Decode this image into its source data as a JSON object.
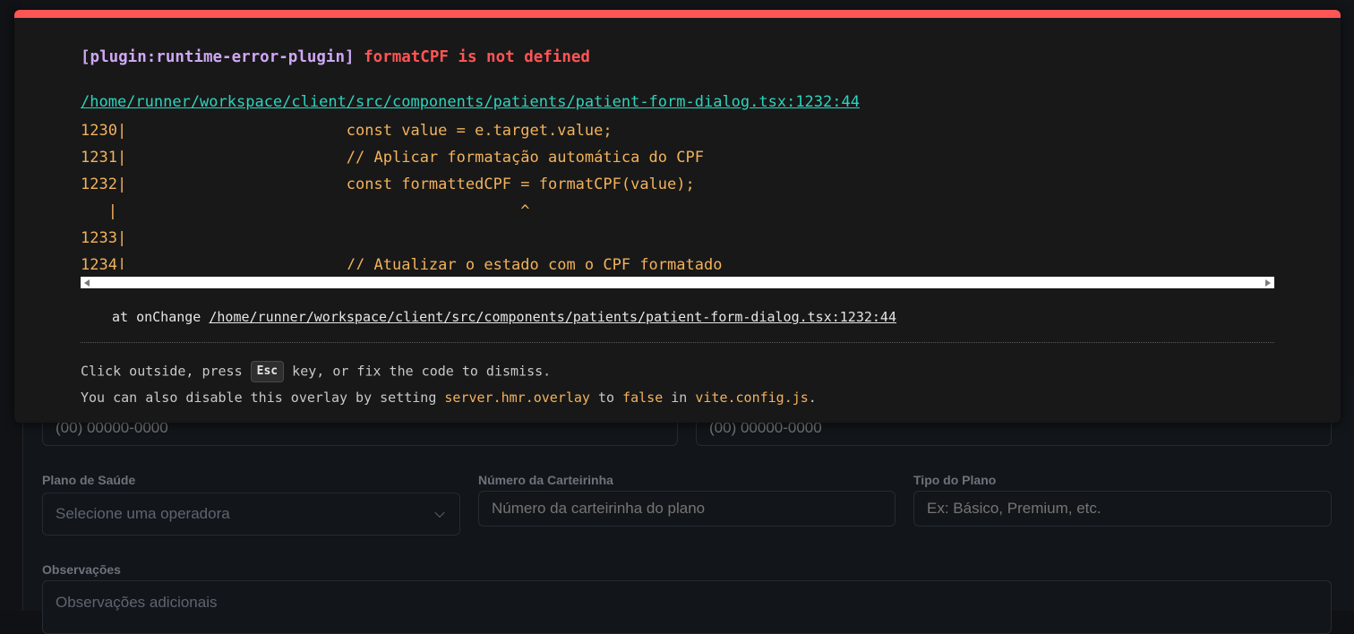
{
  "overlay": {
    "plugin": "[plugin:runtime-error-plugin]",
    "message": "formatCPF is not defined",
    "file": "/home/runner/workspace/client/src/components/patients/patient-form-dialog.tsx:1232:44",
    "frame_lines": [
      "1230|                        const value = e.target.value;",
      "1231|                        // Aplicar formatação automática do CPF",
      "1232|                        const formattedCPF = formatCPF(value);",
      "   |                                            ^",
      "1233|",
      "1234|                        // Atualizar o estado com o CPF formatado"
    ],
    "stack_prefix": "at onChange ",
    "stack_path": "/home/runner/workspace/client/src/components/patients/patient-form-dialog.tsx:1232:44",
    "tip1_before": "Click outside, press ",
    "tip1_key": "Esc",
    "tip1_after": " key, or fix the code to dismiss.",
    "tip2_a": "You can also disable this overlay by setting ",
    "tip2_code1": "server.hmr.overlay",
    "tip2_b": " to ",
    "tip2_code2": "false",
    "tip2_c": " in ",
    "tip2_code3": "vite.config.js",
    "tip2_d": "."
  },
  "form": {
    "phone_placeholder_1": "(00) 00000-0000",
    "phone_placeholder_2": "(00) 00000-0000",
    "health_plan_label": "Plano de Saúde",
    "health_plan_value": "Selecione uma operadora",
    "card_number_label": "Número da Carteirinha",
    "card_number_placeholder": "Número da carteirinha do plano",
    "plan_type_label": "Tipo do Plano",
    "plan_type_placeholder": "Ex: Básico, Premium, etc.",
    "notes_label": "Observações",
    "notes_placeholder": "Observações adicionais"
  },
  "colors": {
    "error_red": "#ff5555",
    "plugin_purple": "#cfa7f5",
    "link_teal": "#2dd4bf",
    "code_yellow": "#f2b25c"
  }
}
